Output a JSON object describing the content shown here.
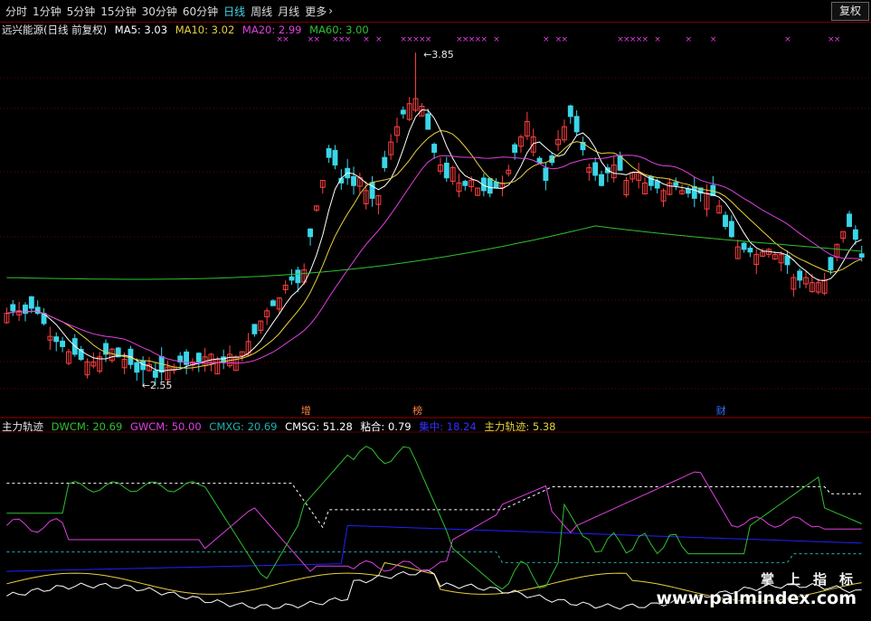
{
  "toolbar": {
    "tabs": [
      "分时",
      "1分钟",
      "5分钟",
      "15分钟",
      "30分钟",
      "60分钟",
      "日线",
      "周线",
      "月线",
      "更多"
    ],
    "active_tab": "日线",
    "restore_label": "复权"
  },
  "main_legend": {
    "title": "远兴能源(日线 前复权)",
    "ma5": "MA5: 3.03",
    "ma10": "MA10: 3.02",
    "ma20": "MA20: 2.99",
    "ma60": "MA60: 3.00"
  },
  "sub_legend": {
    "title": "主力轨迹",
    "dwcm": "DWCM: 20.69",
    "gwcm": "GWCM: 50.00",
    "cmxg": "CMXG: 20.69",
    "cmsg": "CMSG: 51.28",
    "nianhe": "粘合: 0.79",
    "jizhong": "集中: 18.24",
    "zhuli": "主力轨迹: 5.38"
  },
  "markers": {
    "high": "3.85",
    "low": "2.55"
  },
  "signals": [
    {
      "bar": 48,
      "label": "增"
    },
    {
      "bar": 66,
      "label": "榜"
    },
    {
      "bar": 115,
      "label": "财"
    }
  ],
  "watermark": {
    "cn": "掌上指标",
    "url": "www.palmindex.com"
  },
  "colors": {
    "up": "#ff4040",
    "down": "#3ad6e8",
    "ma5": "#ffffff",
    "ma10": "#e8d040",
    "ma20": "#e040e0",
    "ma60": "#30c030",
    "active": "#47d5e6",
    "grid": "#700000",
    "dwcm": "#30c030",
    "gwcm": "#e040e0",
    "cmxg": "#20b0b0",
    "cmsg": "#ffffff",
    "jizhong": "#2020ff",
    "zhuli": "#e8d040"
  },
  "chart_data": {
    "type": "candlestick",
    "price_range": [
      2.5,
      3.9
    ],
    "closes": [
      2.83,
      2.84,
      2.84,
      2.83,
      2.85,
      2.83,
      2.79,
      2.74,
      2.72,
      2.7,
      2.68,
      2.67,
      2.65,
      2.64,
      2.64,
      2.66,
      2.67,
      2.69,
      2.66,
      2.65,
      2.63,
      2.6,
      2.61,
      2.63,
      2.58,
      2.6,
      2.62,
      2.62,
      2.64,
      2.63,
      2.64,
      2.64,
      2.66,
      2.67,
      2.65,
      2.64,
      2.67,
      2.66,
      2.68,
      2.72,
      2.75,
      2.8,
      2.84,
      2.86,
      2.89,
      2.94,
      2.96,
      2.95,
      3.0,
      3.13,
      3.25,
      3.35,
      3.44,
      3.41,
      3.34,
      3.36,
      3.33,
      3.36,
      3.31,
      3.28,
      3.29,
      3.4,
      3.5,
      3.56,
      3.61,
      3.65,
      3.67,
      3.64,
      3.55,
      3.46,
      3.41,
      3.36,
      3.4,
      3.34,
      3.33,
      3.35,
      3.32,
      3.31,
      3.3,
      3.32,
      3.34,
      3.39,
      3.46,
      3.52,
      3.58,
      3.52,
      3.42,
      3.35,
      3.42,
      3.51,
      3.56,
      3.6,
      3.54,
      3.47,
      3.4,
      3.37,
      3.33,
      3.38,
      3.41,
      3.39,
      3.35,
      3.38,
      3.38,
      3.34,
      3.33,
      3.32,
      3.31,
      3.34,
      3.33,
      3.31,
      3.3,
      3.28,
      3.3,
      3.3,
      3.29,
      3.25,
      3.17,
      3.13,
      3.09,
      3.08,
      3.07,
      3.06,
      3.07,
      3.08,
      3.06,
      3.06,
      3.02,
      2.97,
      2.96,
      2.97,
      2.95,
      2.95,
      2.96,
      3.0,
      3.1,
      3.15,
      3.17,
      3.12,
      3.05
    ]
  }
}
